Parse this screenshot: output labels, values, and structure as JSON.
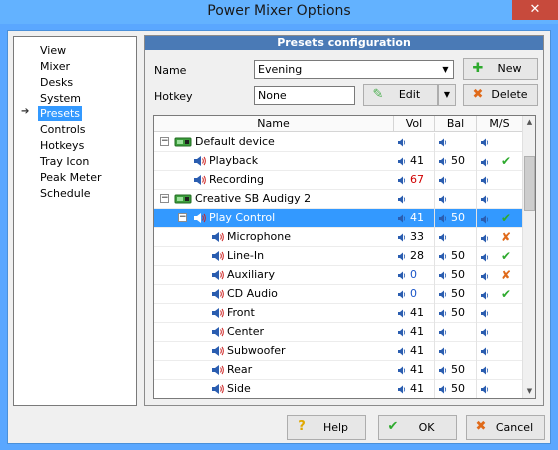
{
  "window": {
    "title": "Power Mixer Options",
    "close": "✕"
  },
  "nav": {
    "items": [
      "View",
      "Mixer",
      "Desks",
      "System",
      "Presets",
      "Controls",
      "Hotkeys",
      "Tray Icon",
      "Peak Meter",
      "Schedule"
    ],
    "selected": "Presets"
  },
  "presets": {
    "header": "Presets configuration",
    "name_label": "Name",
    "name_value": "Evening",
    "hotkey_label": "Hotkey",
    "hotkey_value": "None",
    "new_label": "New",
    "edit_label": "Edit",
    "delete_label": "Delete"
  },
  "grid": {
    "columns": [
      "Name",
      "Vol",
      "Bal",
      "M/S"
    ],
    "rows": [
      {
        "name": "Default device",
        "level": 0,
        "type": "device",
        "vol": "",
        "bal": "",
        "ms": "",
        "expanded": true
      },
      {
        "name": "Playback",
        "level": 1,
        "type": "line",
        "vol": "41",
        "bal": "50",
        "ms": "check",
        "vol_red": false
      },
      {
        "name": "Recording",
        "level": 1,
        "type": "line",
        "vol": "67",
        "bal": "",
        "ms": "",
        "vol_red": true
      },
      {
        "name": "Creative SB Audigy 2",
        "level": 0,
        "type": "device",
        "vol": "",
        "bal": "",
        "ms": "",
        "expanded": true
      },
      {
        "name": "Play Control",
        "level": 1,
        "type": "line",
        "vol": "41",
        "bal": "50",
        "ms": "check",
        "selected": true,
        "expanded": true
      },
      {
        "name": "Microphone",
        "level": 2,
        "type": "line",
        "vol": "33",
        "bal": "",
        "ms": "cross"
      },
      {
        "name": "Line-In",
        "level": 2,
        "type": "line",
        "vol": "28",
        "bal": "50",
        "ms": "check"
      },
      {
        "name": "Auxiliary",
        "level": 2,
        "type": "line",
        "vol": "0",
        "bal": "50",
        "ms": "cross",
        "vol_blue": true
      },
      {
        "name": "CD Audio",
        "level": 2,
        "type": "line",
        "vol": "0",
        "bal": "50",
        "ms": "check",
        "vol_blue": true
      },
      {
        "name": "Front",
        "level": 2,
        "type": "line",
        "vol": "41",
        "bal": "50",
        "ms": ""
      },
      {
        "name": "Center",
        "level": 2,
        "type": "line",
        "vol": "41",
        "bal": "",
        "ms": ""
      },
      {
        "name": "Subwoofer",
        "level": 2,
        "type": "line",
        "vol": "41",
        "bal": "",
        "ms": ""
      },
      {
        "name": "Rear",
        "level": 2,
        "type": "line",
        "vol": "41",
        "bal": "50",
        "ms": ""
      },
      {
        "name": "Side",
        "level": 2,
        "type": "line",
        "vol": "41",
        "bal": "50",
        "ms": ""
      }
    ]
  },
  "footer": {
    "help_label": "Help",
    "ok_label": "OK",
    "cancel_label": "Cancel"
  },
  "colors": {
    "accent": "#3399ff",
    "title_bar": "#63b2ff",
    "close": "#c74a3c",
    "panel_header": "#4a7ab6",
    "check": "#2eaa2e",
    "cross": "#e06a1a"
  }
}
